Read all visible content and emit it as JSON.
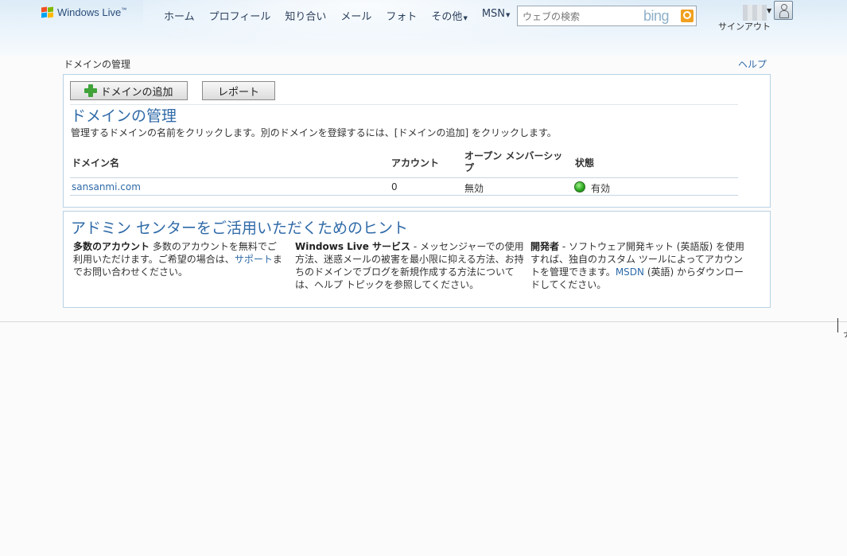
{
  "header": {
    "logo_text": "Windows Live",
    "logo_tm": "™",
    "nav": [
      {
        "label": "ホーム",
        "dropdown": false
      },
      {
        "label": "プロフィール",
        "dropdown": false
      },
      {
        "label": "知り合い",
        "dropdown": false
      },
      {
        "label": "メール",
        "dropdown": false
      },
      {
        "label": "フォト",
        "dropdown": false
      },
      {
        "label": "その他",
        "dropdown": true
      },
      {
        "label": "MSN",
        "dropdown": true
      }
    ],
    "search_placeholder": "ウェブの検索",
    "search_brand": "bing",
    "signout_label": "サインアウト"
  },
  "breadcrumb": "ドメインの管理",
  "help_label": "ヘルプ",
  "manage": {
    "add_button_label": "ドメインの追加",
    "report_button_label": "レポート",
    "title": "ドメインの管理",
    "description": "管理するドメインの名前をクリックします。別のドメインを登録するには、[ドメインの追加] をクリックします。",
    "columns": {
      "domain": "ドメイン名",
      "accounts": "アカウント",
      "open_membership": "オープン メンバーシップ",
      "status": "状態"
    },
    "rows": [
      {
        "domain": "sansanmi.com",
        "accounts": "0",
        "open_membership": "無効",
        "status": "有効"
      }
    ]
  },
  "tips": {
    "title": "アドミン センターをご活用いただくためのヒント",
    "items": [
      {
        "heading": "多数のアカウント",
        "text1": " 多数のアカウントを無料でご利用いただけます。ご希望の場合は、",
        "link": "サポート",
        "text2": "までお問い合わせください。"
      },
      {
        "heading": "Windows Live サービス",
        "text1": " - メッセンジャーでの使用方法、迷惑メールの被害を最小限に抑える方法、お持ちのドメインでブログを新規作成する方法については、ヘルプ トピックを参照してください。",
        "link": "",
        "text2": ""
      },
      {
        "heading": "開発者",
        "text1": " - ソフトウェア開発キット (英語版) を使用すれば、独自のカスタム ツールによってアカウントを管理できます。",
        "link": "MSDN",
        "text2": " (英語) からダウンロードしてください。"
      }
    ]
  },
  "colors": {
    "accent_blue": "#2f6aa8",
    "status_green": "#2eaa22"
  }
}
